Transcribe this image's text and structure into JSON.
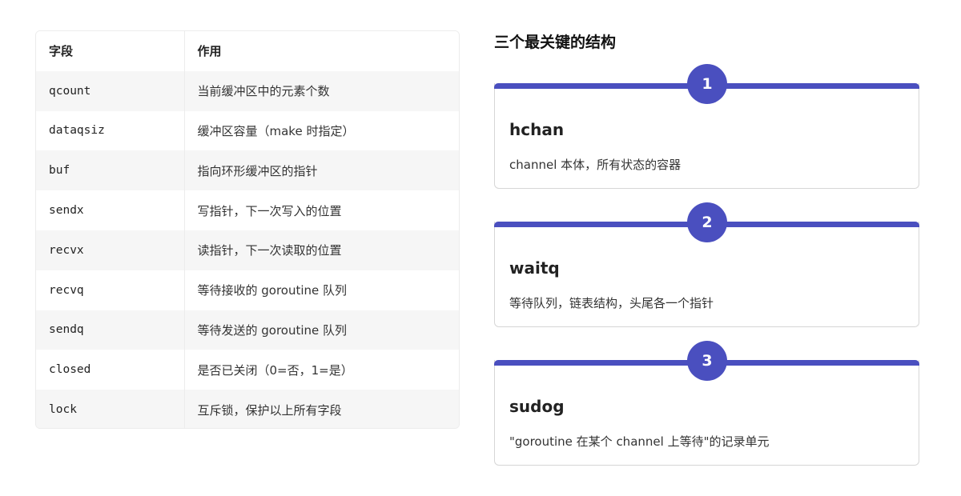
{
  "table": {
    "headers": [
      "字段",
      "作用"
    ],
    "rows": [
      {
        "field": "qcount",
        "desc": "当前缓冲区中的元素个数"
      },
      {
        "field": "dataqsiz",
        "desc": "缓冲区容量（make 时指定）"
      },
      {
        "field": "buf",
        "desc": "指向环形缓冲区的指针"
      },
      {
        "field": "sendx",
        "desc": "写指针，下一次写入的位置"
      },
      {
        "field": "recvx",
        "desc": "读指针，下一次读取的位置"
      },
      {
        "field": "recvq",
        "desc": "等待接收的 goroutine 队列"
      },
      {
        "field": "sendq",
        "desc": "等待发送的 goroutine 队列"
      },
      {
        "field": "closed",
        "desc": "是否已关闭（0=否，1=是）"
      },
      {
        "field": "lock",
        "desc": "互斥锁，保护以上所有字段"
      }
    ]
  },
  "section": {
    "title": "三个最关键的结构",
    "cards": [
      {
        "number": "1",
        "title": "hchan",
        "desc": "channel 本体，所有状态的容器"
      },
      {
        "number": "2",
        "title": "waitq",
        "desc": "等待队列，链表结构，头尾各一个指针"
      },
      {
        "number": "3",
        "title": "sudog",
        "desc": "\"goroutine 在某个 channel 上等待\"的记录单元"
      }
    ]
  },
  "colors": {
    "accent": "#4a4fbf",
    "row_alt": "#f6f6f6",
    "border": "#d6d6d6"
  }
}
